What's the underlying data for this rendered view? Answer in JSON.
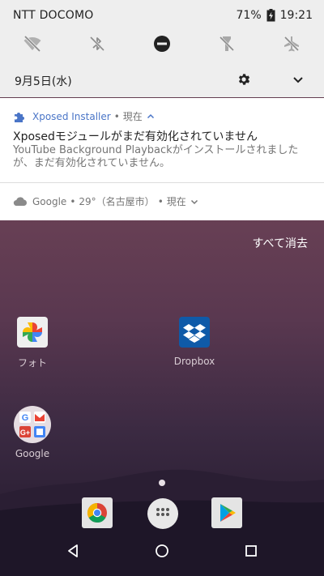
{
  "status_bar": {
    "carrier": "NTT DOCOMO",
    "battery": "71%",
    "time": "19:21"
  },
  "quick_settings": {
    "tiles": [
      "wifi-off-icon",
      "bluetooth-off-icon",
      "do-not-disturb-icon",
      "flashlight-off-icon",
      "airplane-mode-off-icon"
    ],
    "date": "9月5日(水)"
  },
  "notifications": [
    {
      "app": "Xposed Installer",
      "time": "現在",
      "title": "Xposedモジュールがまだ有効化されていません",
      "body_line1": "YouTube Background Playbackがインストールされました",
      "body_line2": "が、まだ有効化されていません。"
    },
    {
      "app": "Google",
      "detail": "29°（名古屋市）",
      "time": "現在"
    }
  ],
  "clear_all": "すべて消去",
  "home": {
    "apps": [
      {
        "name": "photos",
        "label": "フォト"
      },
      {
        "name": "dropbox",
        "label": "Dropbox"
      },
      {
        "name": "google",
        "label": "Google"
      }
    ]
  },
  "colors": {
    "accent": "#4a75c7",
    "shade_bg": "#eeeeee",
    "card_bg": "#ffffff"
  }
}
